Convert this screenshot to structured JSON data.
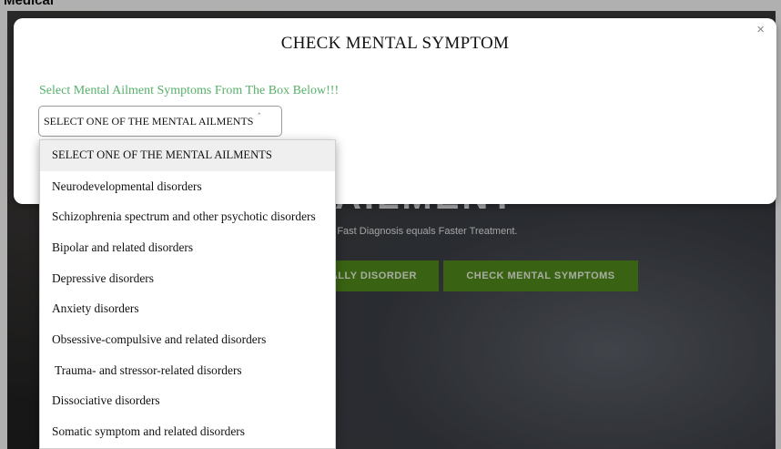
{
  "brand": "Medical",
  "hero": {
    "title": "AILMENT",
    "tagline": "e!!! Fast Diagnosis equals Faster Treatment.",
    "buttons": [
      "ALLY DISORDER",
      "CHECK MENTAL SYMPTOMS"
    ],
    "button_color": "#4f8a1b"
  },
  "modal": {
    "title": "CHECK MENTAL SYMPTOM",
    "close": "×",
    "instruction": "Select Mental Ailment Symptoms From The Box Below!!!",
    "instruction_color": "#56b06a",
    "select": {
      "selected": "SELECT ONE OF THE MENTAL AILMENTS",
      "caret": "ˆ"
    }
  },
  "dropdown": {
    "options": [
      "SELECT ONE OF THE MENTAL AILMENTS",
      "Neurodevelopmental disorders",
      "Schizophrenia spectrum and other psychotic disorders",
      "Bipolar and related disorders",
      "Depressive disorders",
      "Anxiety disorders",
      "Obsessive-compulsive and related disorders",
      "Trauma- and stressor-related disorders",
      "Dissociative disorders",
      "Somatic symptom and related disorders"
    ]
  }
}
